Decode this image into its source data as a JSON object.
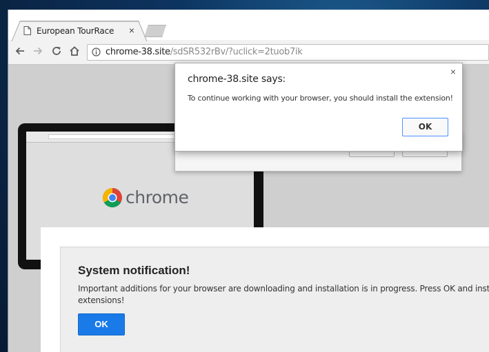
{
  "tab": {
    "title": "European TourRace",
    "close": "×"
  },
  "address": {
    "host": "chrome-38.site",
    "path": "/sdSR532rBv/?uclick=2tuob7ik"
  },
  "page": {
    "logo_text": "chrome"
  },
  "alert": {
    "title": "chrome-38.site says:",
    "message": "To continue working with your browser, you should install the extension!",
    "ok_label": "OK",
    "close": "×"
  },
  "notification": {
    "title": "System notification!",
    "line1": "Important additions for your browser are downloading and installation is in progress. Press OK and install",
    "line2": "extensions!",
    "ok_label": "OK"
  },
  "colors": {
    "accent_blue": "#1a7ae8",
    "focus_ring": "#4d90fe"
  },
  "icons": [
    "page-icon",
    "back-icon",
    "forward-icon",
    "reload-icon",
    "home-icon",
    "info-icon",
    "close-icon",
    "chrome-logo-icon"
  ]
}
